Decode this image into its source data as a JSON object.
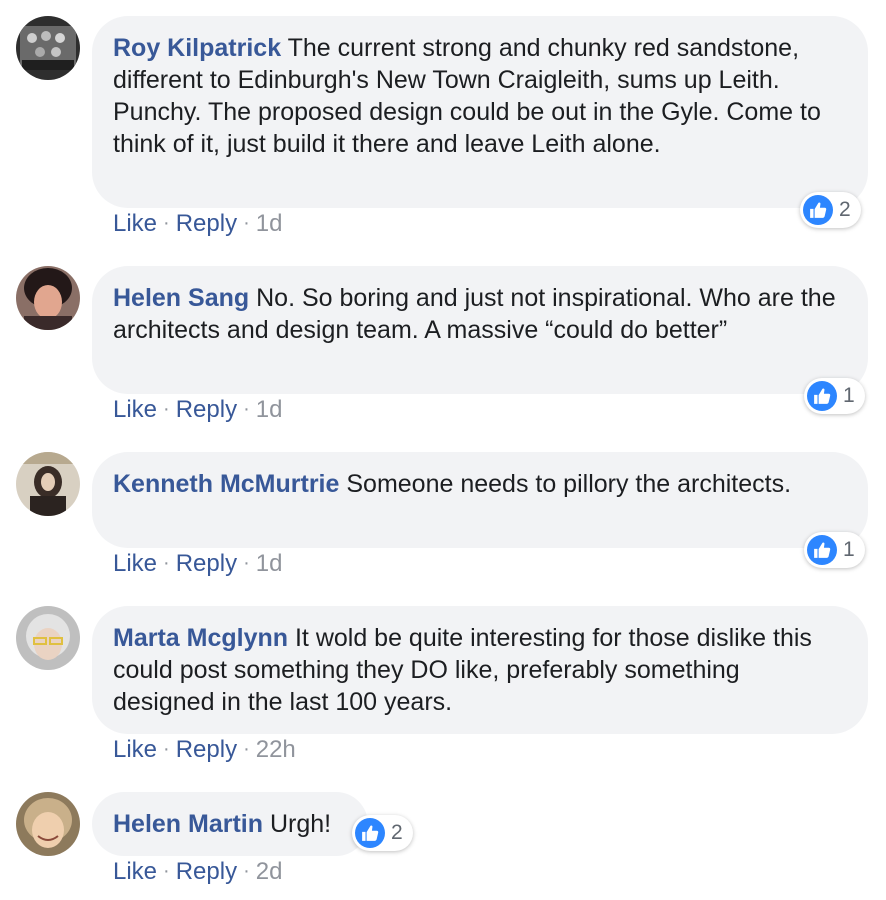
{
  "comments": [
    {
      "author": "Roy Kilpatrick",
      "text": "The current strong and chunky red sandstone, different to Edinburgh's New Town Craigleith, sums up Leith. Punchy. The proposed design could be out in the Gyle. Come to think of it, just build it there and leave Leith alone.",
      "like_label": "Like",
      "reply_label": "Reply",
      "time": "1d",
      "reaction_count": "2",
      "avatar_colors": [
        "#3b3b3b",
        "#9a9a9a"
      ]
    },
    {
      "author": "Helen Sang",
      "text": "No. So boring and just not inspirational. Who are the architects and design team. A massive “could do better”",
      "like_label": "Like",
      "reply_label": "Reply",
      "time": "1d",
      "reaction_count": "1",
      "avatar_colors": [
        "#2a1f1f",
        "#d9a08a"
      ]
    },
    {
      "author": "Kenneth McMurtrie",
      "text": "Someone needs to pillory the architects.",
      "like_label": "Like",
      "reply_label": "Reply",
      "time": "1d",
      "reaction_count": "1",
      "avatar_colors": [
        "#d7cfc0",
        "#3a2e2a"
      ]
    },
    {
      "author": "Marta Mcglynn",
      "text": "It wold be quite interesting for those dislike this could post something they DO like, preferably something designed in the last 100 years.",
      "like_label": "Like",
      "reply_label": "Reply",
      "time": "22h",
      "reaction_count": "",
      "avatar_colors": [
        "#c9c9c9",
        "#e8d3c4"
      ]
    },
    {
      "author": "Helen Martin",
      "text": "Urgh!",
      "like_label": "Like",
      "reply_label": "Reply",
      "time": "2d",
      "reaction_count": "2",
      "avatar_colors": [
        "#9b8a6a",
        "#e9c9a8"
      ]
    }
  ],
  "colors": {
    "author": "#385898",
    "bubble": "#f2f3f5",
    "like_badge": "#2d86ff",
    "meta": "#90949c"
  }
}
